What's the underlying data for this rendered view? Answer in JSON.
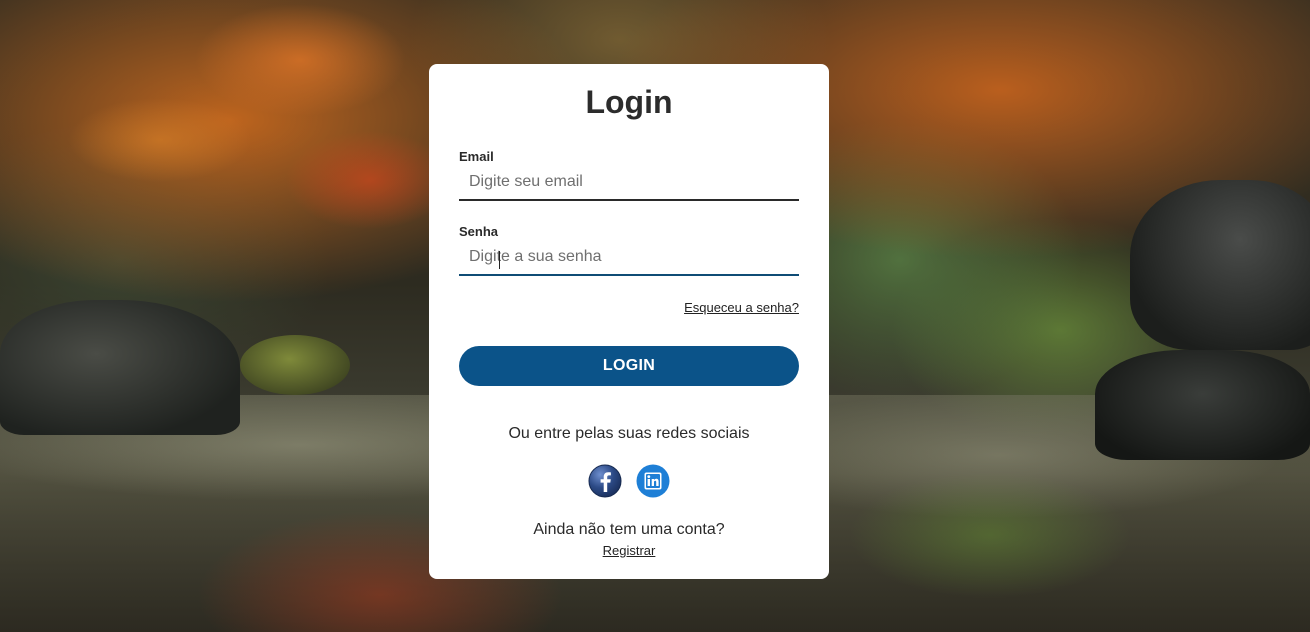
{
  "login": {
    "title": "Login",
    "email": {
      "label": "Email",
      "placeholder": "Digite seu email",
      "value": ""
    },
    "password": {
      "label": "Senha",
      "placeholder": "Digite a sua senha",
      "value": ""
    },
    "forgot_link": "Esqueceu a senha?",
    "submit_label": "LOGIN",
    "social_prompt": "Ou entre pelas suas redes sociais",
    "socials": [
      {
        "name": "facebook",
        "icon": "facebook-icon",
        "color": "#2c4a86"
      },
      {
        "name": "linkedin",
        "icon": "linkedin-icon",
        "color": "#1e7fd6"
      }
    ],
    "register_prompt": "Ainda não tem uma conta?",
    "register_link": "Registrar"
  },
  "colors": {
    "primary": "#0b5389",
    "card": "#ffffff",
    "text": "#2a2a2a"
  }
}
